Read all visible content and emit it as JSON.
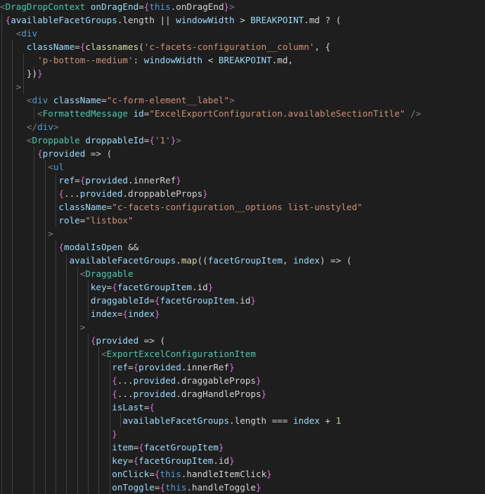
{
  "theme": {
    "background": "#1e1e1e",
    "text": "#d4d4d4",
    "component": "#4ec9b0",
    "attribute": "#9cdcfe",
    "string": "#ce9178",
    "keyword": "#569cd6",
    "function": "#dcdcaa",
    "number": "#b5cea8",
    "punctuation": "#808080"
  },
  "lines": [
    [
      [
        "punct",
        "<"
      ],
      [
        "cmp",
        "DragDropContext"
      ],
      [
        "txt",
        " "
      ],
      [
        "attr",
        "onDragEnd"
      ],
      [
        "txt",
        "="
      ],
      [
        "brace",
        "{"
      ],
      [
        "kw",
        "this"
      ],
      [
        "txt",
        ".onDragEnd"
      ],
      [
        "brace",
        "}"
      ],
      [
        "punct",
        ">"
      ]
    ],
    [
      [
        "txt",
        " "
      ],
      [
        "brace",
        "{"
      ],
      [
        "attr",
        "availableFacetGroups"
      ],
      [
        "txt",
        ".length || "
      ],
      [
        "attr",
        "windowWidth"
      ],
      [
        "txt",
        " > "
      ],
      [
        "attr",
        "BREAKPOINT"
      ],
      [
        "txt",
        ".md ? ("
      ]
    ],
    [
      [
        "txt",
        "   "
      ],
      [
        "punct",
        "<"
      ],
      [
        "tag",
        "div"
      ]
    ],
    [
      [
        "txt",
        "     "
      ],
      [
        "attr",
        "className"
      ],
      [
        "txt",
        "="
      ],
      [
        "brace",
        "{"
      ],
      [
        "fn",
        "classnames"
      ],
      [
        "txt",
        "("
      ],
      [
        "str",
        "'c-facets-configuration__column'"
      ],
      [
        "txt",
        ", {"
      ]
    ],
    [
      [
        "txt",
        "       "
      ],
      [
        "str",
        "'p-bottom--medium'"
      ],
      [
        "txt",
        ": "
      ],
      [
        "attr",
        "windowWidth"
      ],
      [
        "txt",
        " < "
      ],
      [
        "attr",
        "BREAKPOINT"
      ],
      [
        "txt",
        ".md,"
      ]
    ],
    [
      [
        "txt",
        "     "
      ],
      [
        "txt",
        "})"
      ],
      [
        "brace",
        "}"
      ]
    ],
    [
      [
        "txt",
        "   "
      ],
      [
        "punct",
        ">"
      ]
    ],
    [
      [
        "txt",
        "     "
      ],
      [
        "punct",
        "<"
      ],
      [
        "tag",
        "div"
      ],
      [
        "txt",
        " "
      ],
      [
        "attr",
        "className"
      ],
      [
        "txt",
        "="
      ],
      [
        "str",
        "\"c-form-element__label\""
      ],
      [
        "punct",
        ">"
      ]
    ],
    [
      [
        "txt",
        "       "
      ],
      [
        "punct",
        "<"
      ],
      [
        "cmp",
        "FormattedMessage"
      ],
      [
        "txt",
        " "
      ],
      [
        "attr",
        "id"
      ],
      [
        "txt",
        "="
      ],
      [
        "str",
        "\"ExcelExportConfiguration.availableSectionTitle\""
      ],
      [
        "txt",
        " "
      ],
      [
        "punct",
        "/>"
      ]
    ],
    [
      [
        "txt",
        "     "
      ],
      [
        "punct",
        "</"
      ],
      [
        "tag",
        "div"
      ],
      [
        "punct",
        ">"
      ]
    ],
    [
      [
        "txt",
        "     "
      ],
      [
        "punct",
        "<"
      ],
      [
        "cmp",
        "Droppable"
      ],
      [
        "txt",
        " "
      ],
      [
        "attr",
        "droppableId"
      ],
      [
        "txt",
        "="
      ],
      [
        "brace",
        "{"
      ],
      [
        "str",
        "'1'"
      ],
      [
        "brace",
        "}"
      ],
      [
        "punct",
        ">"
      ]
    ],
    [
      [
        "txt",
        "       "
      ],
      [
        "brace",
        "{"
      ],
      [
        "attr",
        "provided"
      ],
      [
        "txt",
        " => ("
      ]
    ],
    [
      [
        "txt",
        "         "
      ],
      [
        "punct",
        "<"
      ],
      [
        "tag",
        "ul"
      ]
    ],
    [
      [
        "txt",
        "           "
      ],
      [
        "attr",
        "ref"
      ],
      [
        "txt",
        "="
      ],
      [
        "brace",
        "{"
      ],
      [
        "attr",
        "provided"
      ],
      [
        "txt",
        ".innerRef"
      ],
      [
        "brace",
        "}"
      ]
    ],
    [
      [
        "txt",
        "           "
      ],
      [
        "brace",
        "{"
      ],
      [
        "txt",
        "..."
      ],
      [
        "attr",
        "provided"
      ],
      [
        "txt",
        ".droppableProps"
      ],
      [
        "brace",
        "}"
      ]
    ],
    [
      [
        "txt",
        "           "
      ],
      [
        "attr",
        "className"
      ],
      [
        "txt",
        "="
      ],
      [
        "str",
        "\"c-facets-configuration__options list-unstyled\""
      ]
    ],
    [
      [
        "txt",
        "           "
      ],
      [
        "attr",
        "role"
      ],
      [
        "txt",
        "="
      ],
      [
        "str",
        "\"listbox\""
      ]
    ],
    [
      [
        "txt",
        "         "
      ],
      [
        "punct",
        ">"
      ]
    ],
    [
      [
        "txt",
        "           "
      ],
      [
        "brace",
        "{"
      ],
      [
        "attr",
        "modalIsOpen"
      ],
      [
        "txt",
        " &&"
      ]
    ],
    [
      [
        "txt",
        "             "
      ],
      [
        "attr",
        "availableFacetGroups"
      ],
      [
        "txt",
        "."
      ],
      [
        "fn",
        "map"
      ],
      [
        "txt",
        "(("
      ],
      [
        "attr",
        "facetGroupItem"
      ],
      [
        "txt",
        ", "
      ],
      [
        "attr",
        "index"
      ],
      [
        "txt",
        ") => ("
      ]
    ],
    [
      [
        "txt",
        "               "
      ],
      [
        "punct",
        "<"
      ],
      [
        "cmp",
        "Draggable"
      ]
    ],
    [
      [
        "txt",
        "                 "
      ],
      [
        "attr",
        "key"
      ],
      [
        "txt",
        "="
      ],
      [
        "brace",
        "{"
      ],
      [
        "attr",
        "facetGroupItem"
      ],
      [
        "txt",
        ".id"
      ],
      [
        "brace",
        "}"
      ]
    ],
    [
      [
        "txt",
        "                 "
      ],
      [
        "attr",
        "draggableId"
      ],
      [
        "txt",
        "="
      ],
      [
        "brace",
        "{"
      ],
      [
        "attr",
        "facetGroupItem"
      ],
      [
        "txt",
        ".id"
      ],
      [
        "brace",
        "}"
      ]
    ],
    [
      [
        "txt",
        "                 "
      ],
      [
        "attr",
        "index"
      ],
      [
        "txt",
        "="
      ],
      [
        "brace",
        "{"
      ],
      [
        "attr",
        "index"
      ],
      [
        "brace",
        "}"
      ]
    ],
    [
      [
        "txt",
        "               "
      ],
      [
        "punct",
        ">"
      ]
    ],
    [
      [
        "txt",
        "                 "
      ],
      [
        "brace",
        "{"
      ],
      [
        "attr",
        "provided"
      ],
      [
        "txt",
        " => ("
      ]
    ],
    [
      [
        "txt",
        "                   "
      ],
      [
        "punct",
        "<"
      ],
      [
        "cmp",
        "ExportExcelConfigurationItem"
      ]
    ],
    [
      [
        "txt",
        "                     "
      ],
      [
        "attr",
        "ref"
      ],
      [
        "txt",
        "="
      ],
      [
        "brace",
        "{"
      ],
      [
        "attr",
        "provided"
      ],
      [
        "txt",
        ".innerRef"
      ],
      [
        "brace",
        "}"
      ]
    ],
    [
      [
        "txt",
        "                     "
      ],
      [
        "brace",
        "{"
      ],
      [
        "txt",
        "..."
      ],
      [
        "attr",
        "provided"
      ],
      [
        "txt",
        ".draggableProps"
      ],
      [
        "brace",
        "}"
      ]
    ],
    [
      [
        "txt",
        "                     "
      ],
      [
        "brace",
        "{"
      ],
      [
        "txt",
        "..."
      ],
      [
        "attr",
        "provided"
      ],
      [
        "txt",
        ".dragHandleProps"
      ],
      [
        "brace",
        "}"
      ]
    ],
    [
      [
        "txt",
        "                     "
      ],
      [
        "attr",
        "isLast"
      ],
      [
        "txt",
        "="
      ],
      [
        "brace",
        "{"
      ]
    ],
    [
      [
        "txt",
        "                       "
      ],
      [
        "attr",
        "availableFacetGroups"
      ],
      [
        "txt",
        ".length === "
      ],
      [
        "attr",
        "index"
      ],
      [
        "txt",
        " + "
      ],
      [
        "num",
        "1"
      ]
    ],
    [
      [
        "txt",
        "                     "
      ],
      [
        "brace",
        "}"
      ]
    ],
    [
      [
        "txt",
        "                     "
      ],
      [
        "attr",
        "item"
      ],
      [
        "txt",
        "="
      ],
      [
        "brace",
        "{"
      ],
      [
        "attr",
        "facetGroupItem"
      ],
      [
        "brace",
        "}"
      ]
    ],
    [
      [
        "txt",
        "                     "
      ],
      [
        "attr",
        "key"
      ],
      [
        "txt",
        "="
      ],
      [
        "brace",
        "{"
      ],
      [
        "attr",
        "facetGroupItem"
      ],
      [
        "txt",
        ".id"
      ],
      [
        "brace",
        "}"
      ]
    ],
    [
      [
        "txt",
        "                     "
      ],
      [
        "attr",
        "onClick"
      ],
      [
        "txt",
        "="
      ],
      [
        "brace",
        "{"
      ],
      [
        "kw",
        "this"
      ],
      [
        "txt",
        ".handleItemClick"
      ],
      [
        "brace",
        "}"
      ]
    ],
    [
      [
        "txt",
        "                     "
      ],
      [
        "attr",
        "onToggle"
      ],
      [
        "txt",
        "="
      ],
      [
        "brace",
        "{"
      ],
      [
        "kw",
        "this"
      ],
      [
        "txt",
        ".handleToggle"
      ],
      [
        "brace",
        "}"
      ]
    ]
  ]
}
